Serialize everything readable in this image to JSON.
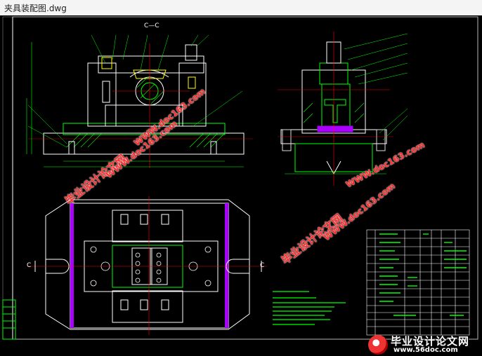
{
  "window": {
    "title": "夹具装配图.dwg"
  },
  "drawing": {
    "section_label": "C—C",
    "cut_left": "C",
    "cut_right": "C"
  },
  "watermarks": {
    "cn_text": "毕业设计论文网",
    "url_text": "WWW.doc163.com",
    "brand_title": "毕业设计论文网",
    "brand_url": "www.56doc.com"
  }
}
